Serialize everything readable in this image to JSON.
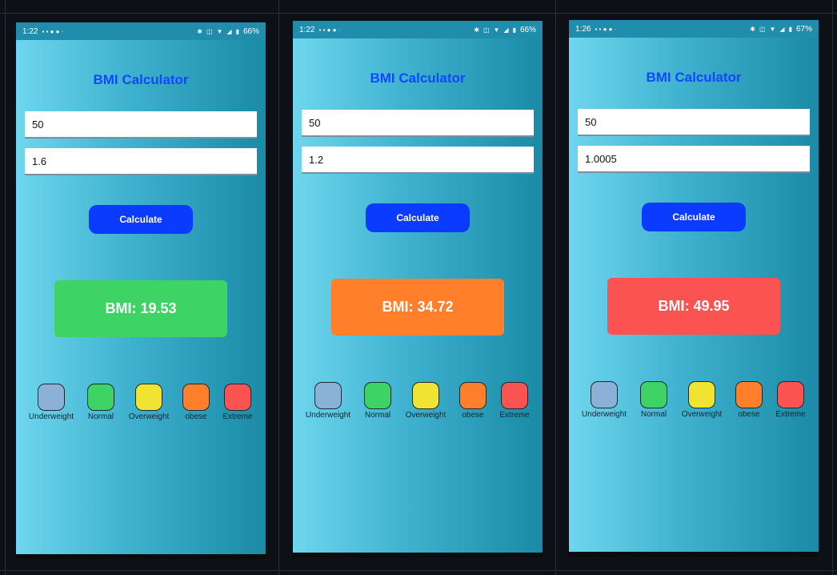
{
  "app_title": "BMI Calculator",
  "calculate_label": "Calculate",
  "colors": {
    "title": "#0f48ff",
    "button": "#0a3bff",
    "gradient": [
      "#6fd6ee",
      "#1a8aa6"
    ]
  },
  "categories": [
    {
      "label": "Underweight",
      "color": "#8bb1d6"
    },
    {
      "label": "Normal",
      "color": "#3dd365"
    },
    {
      "label": "Overweight",
      "color": "#f1e331"
    },
    {
      "label": "obese",
      "color": "#ff7f2a"
    },
    {
      "label": "Extreme",
      "color": "#fb5252"
    }
  ],
  "phones": [
    {
      "status": {
        "time": "1:22",
        "battery": "66%"
      },
      "weight": "50",
      "height": "1.6",
      "result": "BMI: 19.53",
      "result_color": "#3dd365"
    },
    {
      "status": {
        "time": "1:22",
        "battery": "66%"
      },
      "weight": "50",
      "height": "1.2",
      "result": "BMI: 34.72",
      "result_color": "#ff7f2a"
    },
    {
      "status": {
        "time": "1:26",
        "battery": "67%"
      },
      "weight": "50",
      "height": "1.0005",
      "result": "BMI: 49.95",
      "result_color": "#fb5252"
    }
  ]
}
